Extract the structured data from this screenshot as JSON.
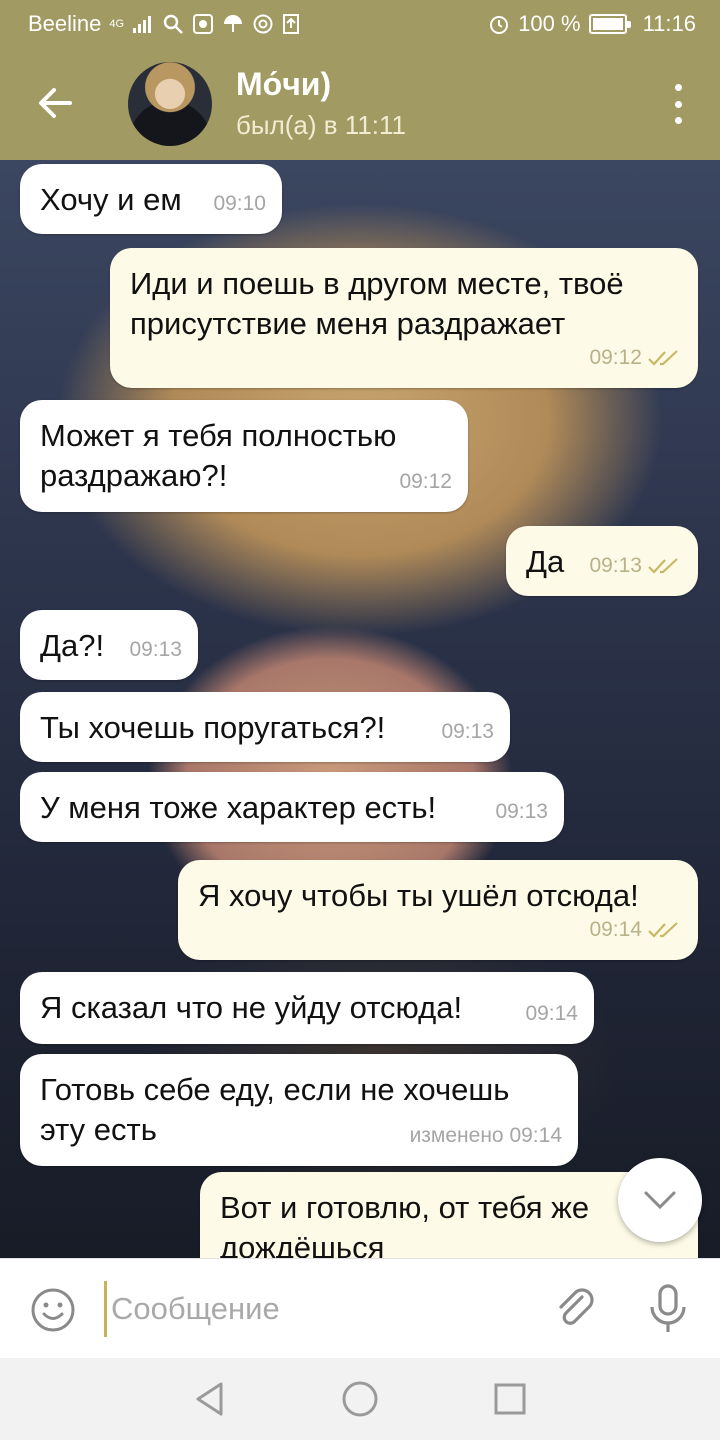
{
  "status_bar": {
    "carrier": "Beeline",
    "network": "4G",
    "battery_text": "100 %",
    "time": "11:16"
  },
  "header": {
    "contact_name": "Мо́чи)",
    "last_seen": "был(а) в 11:11",
    "icons": [
      "back-arrow-icon",
      "more-vert-icon"
    ]
  },
  "messages": [
    {
      "dir": "in",
      "text": "Хочу и ем",
      "time": "09:10"
    },
    {
      "dir": "out",
      "text": "Иди и поешь в другом месте, твоё присутствие меня раздражает",
      "time": "09:12",
      "status": "read"
    },
    {
      "dir": "in",
      "text": "Может я тебя полностью раздражаю?!",
      "time": "09:12"
    },
    {
      "dir": "out",
      "text": "Да",
      "time": "09:13",
      "status": "read"
    },
    {
      "dir": "in",
      "text": "Да?!",
      "time": "09:13"
    },
    {
      "dir": "in",
      "text": "Ты хочешь поругаться?!",
      "time": "09:13"
    },
    {
      "dir": "in",
      "text": "У меня тоже характер есть!",
      "time": "09:13"
    },
    {
      "dir": "out",
      "text": "Я хочу чтобы ты ушёл отсюда!",
      "time": "09:14",
      "status": "read"
    },
    {
      "dir": "in",
      "text": "Я сказал что не уйду отсюда!",
      "time": "09:14"
    },
    {
      "dir": "in",
      "text": "Готовь себе еду, если не хочешь эту есть",
      "time": "изменено 09:14"
    },
    {
      "dir": "out",
      "text": "Вот и готовлю, от тебя же дождёшься",
      "time": ""
    }
  ],
  "composer": {
    "placeholder": "Сообщение",
    "icons": [
      "emoji-icon",
      "attach-icon",
      "mic-icon"
    ]
  },
  "colors": {
    "header": "#a19a62",
    "incoming_bubble": "#ffffff",
    "outgoing_bubble": "#fdfbe7",
    "read_check": "#c8b864"
  }
}
